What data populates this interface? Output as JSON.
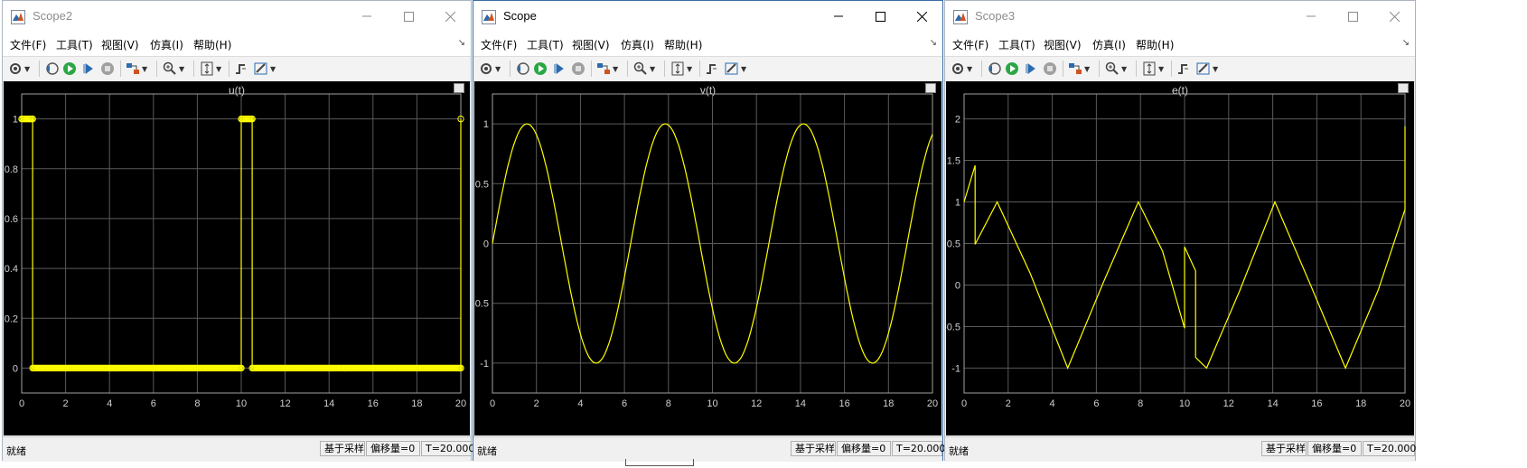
{
  "windows": [
    {
      "title": "Scope2",
      "active": false,
      "menu": [
        "文件(F)",
        "工具(T)",
        "视图(V)",
        "仿真(I)",
        "帮助(H)"
      ],
      "plot_title": "u(t)",
      "status": {
        "ready": "就绪",
        "mode": "基于采样",
        "offset": "偏移量=0",
        "time": "T=20.000"
      },
      "chart_data": {
        "type": "line",
        "title": "u(t)",
        "xlim": [
          0,
          20
        ],
        "ylim": [
          -0.1,
          1.1
        ],
        "xticks": [
          0,
          2,
          4,
          6,
          8,
          10,
          12,
          14,
          16,
          18,
          20
        ],
        "yticks": [
          0,
          0.2,
          0.4,
          0.6,
          0.8,
          1
        ],
        "ytick_labels": [
          "0",
          "0.2",
          "0.4",
          "0.6",
          "0.8",
          "1"
        ],
        "grid": true,
        "series": [
          {
            "color": "#ffff00",
            "markers": "circle",
            "x": [
              0,
              0.5,
              0.5,
              10,
              10,
              10.5,
              10.5,
              20,
              20
            ],
            "y": [
              1,
              1,
              0,
              0,
              1,
              1,
              0,
              0,
              1
            ]
          }
        ]
      }
    },
    {
      "title": "Scope",
      "active": true,
      "menu": [
        "文件(F)",
        "工具(T)",
        "视图(V)",
        "仿真(I)",
        "帮助(H)"
      ],
      "plot_title": "v(t)",
      "status": {
        "ready": "就绪",
        "mode": "基于采样",
        "offset": "偏移量=0",
        "time": "T=20.000"
      },
      "chart_data": {
        "type": "line",
        "title": "v(t)",
        "xlim": [
          0,
          20
        ],
        "ylim": [
          -1.25,
          1.25
        ],
        "xticks": [
          0,
          2,
          4,
          6,
          8,
          10,
          12,
          14,
          16,
          18,
          20
        ],
        "yticks": [
          -1,
          -0.5,
          0,
          0.5,
          1
        ],
        "ytick_labels": [
          "-1",
          "-0.5",
          "0",
          "0.5",
          "1"
        ],
        "grid": true,
        "series": [
          {
            "color": "#ffff00",
            "function": "sin(t)",
            "x_range": [
              0,
              20
            ]
          }
        ]
      }
    },
    {
      "title": "Scope3",
      "active": false,
      "menu": [
        "文件(F)",
        "工具(T)",
        "视图(V)",
        "仿真(I)",
        "帮助(H)"
      ],
      "plot_title": "e(t)",
      "status": {
        "ready": "就绪",
        "mode": "基于采样",
        "offset": "偏移量=0",
        "time": "T=20.000"
      },
      "chart_data": {
        "type": "line",
        "title": "e(t)",
        "xlim": [
          0,
          20
        ],
        "ylim": [
          -1.3,
          2.3
        ],
        "xticks": [
          0,
          2,
          4,
          6,
          8,
          10,
          12,
          14,
          16,
          18,
          20
        ],
        "yticks": [
          -1,
          -0.5,
          0,
          0.5,
          1,
          1.5,
          2
        ],
        "ytick_labels": [
          "-1",
          "-0.5",
          "0",
          "0.5",
          "1",
          "1.5",
          "2"
        ],
        "grid": true,
        "series": [
          {
            "color": "#ffff00",
            "x": [
              0,
              0.5,
              0.5,
              1.5,
              3,
              4.7,
              6.3,
              7.9,
              9.0,
              10.0,
              10.0,
              10.5,
              10.5,
              11.0,
              12.5,
              14.1,
              15.7,
              17.3,
              18.8,
              20.0,
              20.0
            ],
            "y": [
              1,
              1.44,
              0.49,
              1.0,
              0.14,
              -1.0,
              0.02,
              1.0,
              0.41,
              -0.52,
              0.46,
              0.17,
              -0.87,
              -1.0,
              -0.07,
              1.0,
              0.01,
              -1.0,
              -0.05,
              0.91,
              1.91
            ]
          }
        ]
      }
    }
  ]
}
